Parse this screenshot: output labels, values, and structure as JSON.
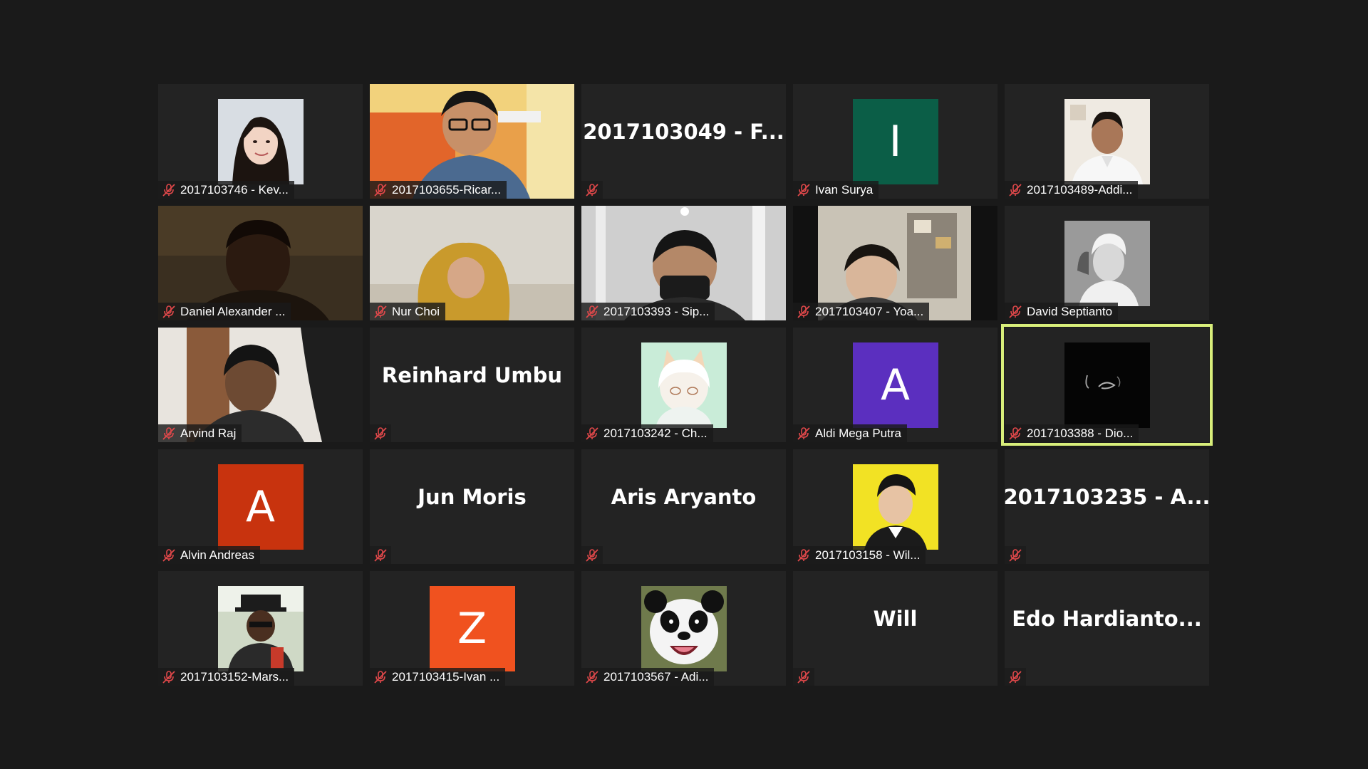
{
  "meeting": {
    "participants": [
      {
        "name": "2017103746 - Kev...",
        "display": "video"
      },
      {
        "name": "2017103655-Ricar...",
        "display": "video"
      },
      {
        "name": "",
        "big_name": "2017103049 - F...",
        "display": "name"
      },
      {
        "name": "Ivan Surya",
        "display": "letter",
        "letter": "I",
        "color": "#0b5e47"
      },
      {
        "name": "2017103489-Addi...",
        "display": "video"
      },
      {
        "name": "Daniel Alexander ...",
        "display": "video"
      },
      {
        "name": "Nur Choi",
        "display": "video"
      },
      {
        "name": "2017103393 - Sip...",
        "display": "video"
      },
      {
        "name": "2017103407 - Yoa...",
        "display": "video"
      },
      {
        "name": "David Septianto",
        "display": "video"
      },
      {
        "name": "Arvind Raj",
        "display": "video"
      },
      {
        "name": "",
        "big_name": "Reinhard Umbu",
        "display": "name"
      },
      {
        "name": "2017103242 - Ch...",
        "display": "video"
      },
      {
        "name": "Aldi Mega Putra",
        "display": "letter",
        "letter": "A",
        "color": "#5b2fbf"
      },
      {
        "name": "2017103388 - Dio...",
        "display": "video",
        "active_speaker": true
      },
      {
        "name": "Alvin Andreas",
        "display": "letter",
        "letter": "A",
        "color": "#c8330e"
      },
      {
        "name": "",
        "big_name": "Jun Moris",
        "display": "name"
      },
      {
        "name": "",
        "big_name": "Aris Aryanto",
        "display": "name"
      },
      {
        "name": "2017103158 - Wil...",
        "display": "video"
      },
      {
        "name": "",
        "big_name": "2017103235 - A...",
        "display": "name"
      },
      {
        "name": "2017103152-Mars...",
        "display": "video"
      },
      {
        "name": "2017103415-Ivan ...",
        "display": "letter",
        "letter": "Z",
        "color": "#f0521f"
      },
      {
        "name": "2017103567 - Adi...",
        "display": "video"
      },
      {
        "name": "",
        "big_name": "Will",
        "display": "name"
      },
      {
        "name": "",
        "big_name": "Edo Hardianto...",
        "display": "name"
      }
    ]
  },
  "colors": {
    "background": "#1a1a1a",
    "tile": "#232323",
    "active_border": "#d8ee7a",
    "mute_icon": "#e0484a"
  }
}
